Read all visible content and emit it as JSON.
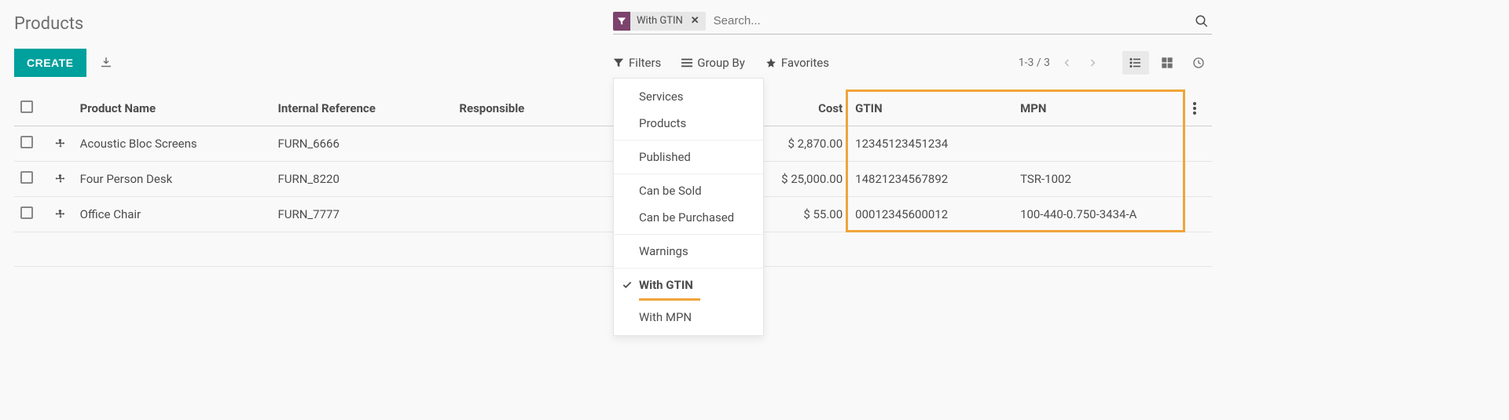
{
  "page_title": "Products",
  "create_label": "CREATE",
  "search": {
    "placeholder": "Search...",
    "facet_label": "With GTIN"
  },
  "cp": {
    "filters_label": "Filters",
    "groupby_label": "Group By",
    "favorites_label": "Favorites",
    "pager": "1-3 / 3"
  },
  "filters_menu": {
    "group1": [
      "Services",
      "Products"
    ],
    "group2": [
      "Published"
    ],
    "group3": [
      "Can be Sold",
      "Can be Purchased"
    ],
    "group4": [
      "Warnings"
    ],
    "group5": [
      {
        "label": "With GTIN",
        "active": true
      },
      {
        "label": "With MPN",
        "active": false
      }
    ]
  },
  "columns": {
    "name": "Product Name",
    "ref": "Internal Reference",
    "resp": "Responsible",
    "price": "",
    "cost": "Cost",
    "gtin": "GTIN",
    "mpn": "MPN"
  },
  "rows": [
    {
      "name": "Acoustic Bloc Screens",
      "ref": "FURN_6666",
      "resp": "",
      "cost": "$ 2,870.00",
      "gtin": "12345123451234",
      "mpn": ""
    },
    {
      "name": "Four Person Desk",
      "ref": "FURN_8220",
      "resp": "",
      "cost": "$ 25,000.00",
      "gtin": "14821234567892",
      "mpn": "TSR-1002"
    },
    {
      "name": "Office Chair",
      "ref": "FURN_7777",
      "resp": "",
      "cost": "$ 55.00",
      "gtin": "00012345600012",
      "mpn": "100-440-0.750-3434-A"
    }
  ]
}
